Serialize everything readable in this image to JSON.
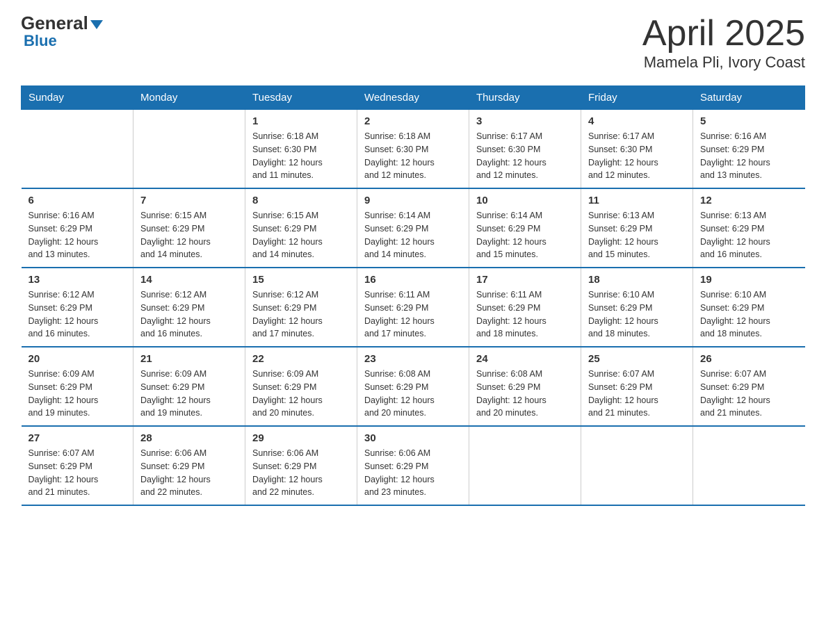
{
  "logo": {
    "general": "General",
    "blue": "Blue",
    "arrow": "▼"
  },
  "title": "April 2025",
  "subtitle": "Mamela Pli, Ivory Coast",
  "header_days": [
    "Sunday",
    "Monday",
    "Tuesday",
    "Wednesday",
    "Thursday",
    "Friday",
    "Saturday"
  ],
  "weeks": [
    [
      {
        "day": "",
        "info": ""
      },
      {
        "day": "",
        "info": ""
      },
      {
        "day": "1",
        "info": "Sunrise: 6:18 AM\nSunset: 6:30 PM\nDaylight: 12 hours\nand 11 minutes."
      },
      {
        "day": "2",
        "info": "Sunrise: 6:18 AM\nSunset: 6:30 PM\nDaylight: 12 hours\nand 12 minutes."
      },
      {
        "day": "3",
        "info": "Sunrise: 6:17 AM\nSunset: 6:30 PM\nDaylight: 12 hours\nand 12 minutes."
      },
      {
        "day": "4",
        "info": "Sunrise: 6:17 AM\nSunset: 6:30 PM\nDaylight: 12 hours\nand 12 minutes."
      },
      {
        "day": "5",
        "info": "Sunrise: 6:16 AM\nSunset: 6:29 PM\nDaylight: 12 hours\nand 13 minutes."
      }
    ],
    [
      {
        "day": "6",
        "info": "Sunrise: 6:16 AM\nSunset: 6:29 PM\nDaylight: 12 hours\nand 13 minutes."
      },
      {
        "day": "7",
        "info": "Sunrise: 6:15 AM\nSunset: 6:29 PM\nDaylight: 12 hours\nand 14 minutes."
      },
      {
        "day": "8",
        "info": "Sunrise: 6:15 AM\nSunset: 6:29 PM\nDaylight: 12 hours\nand 14 minutes."
      },
      {
        "day": "9",
        "info": "Sunrise: 6:14 AM\nSunset: 6:29 PM\nDaylight: 12 hours\nand 14 minutes."
      },
      {
        "day": "10",
        "info": "Sunrise: 6:14 AM\nSunset: 6:29 PM\nDaylight: 12 hours\nand 15 minutes."
      },
      {
        "day": "11",
        "info": "Sunrise: 6:13 AM\nSunset: 6:29 PM\nDaylight: 12 hours\nand 15 minutes."
      },
      {
        "day": "12",
        "info": "Sunrise: 6:13 AM\nSunset: 6:29 PM\nDaylight: 12 hours\nand 16 minutes."
      }
    ],
    [
      {
        "day": "13",
        "info": "Sunrise: 6:12 AM\nSunset: 6:29 PM\nDaylight: 12 hours\nand 16 minutes."
      },
      {
        "day": "14",
        "info": "Sunrise: 6:12 AM\nSunset: 6:29 PM\nDaylight: 12 hours\nand 16 minutes."
      },
      {
        "day": "15",
        "info": "Sunrise: 6:12 AM\nSunset: 6:29 PM\nDaylight: 12 hours\nand 17 minutes."
      },
      {
        "day": "16",
        "info": "Sunrise: 6:11 AM\nSunset: 6:29 PM\nDaylight: 12 hours\nand 17 minutes."
      },
      {
        "day": "17",
        "info": "Sunrise: 6:11 AM\nSunset: 6:29 PM\nDaylight: 12 hours\nand 18 minutes."
      },
      {
        "day": "18",
        "info": "Sunrise: 6:10 AM\nSunset: 6:29 PM\nDaylight: 12 hours\nand 18 minutes."
      },
      {
        "day": "19",
        "info": "Sunrise: 6:10 AM\nSunset: 6:29 PM\nDaylight: 12 hours\nand 18 minutes."
      }
    ],
    [
      {
        "day": "20",
        "info": "Sunrise: 6:09 AM\nSunset: 6:29 PM\nDaylight: 12 hours\nand 19 minutes."
      },
      {
        "day": "21",
        "info": "Sunrise: 6:09 AM\nSunset: 6:29 PM\nDaylight: 12 hours\nand 19 minutes."
      },
      {
        "day": "22",
        "info": "Sunrise: 6:09 AM\nSunset: 6:29 PM\nDaylight: 12 hours\nand 20 minutes."
      },
      {
        "day": "23",
        "info": "Sunrise: 6:08 AM\nSunset: 6:29 PM\nDaylight: 12 hours\nand 20 minutes."
      },
      {
        "day": "24",
        "info": "Sunrise: 6:08 AM\nSunset: 6:29 PM\nDaylight: 12 hours\nand 20 minutes."
      },
      {
        "day": "25",
        "info": "Sunrise: 6:07 AM\nSunset: 6:29 PM\nDaylight: 12 hours\nand 21 minutes."
      },
      {
        "day": "26",
        "info": "Sunrise: 6:07 AM\nSunset: 6:29 PM\nDaylight: 12 hours\nand 21 minutes."
      }
    ],
    [
      {
        "day": "27",
        "info": "Sunrise: 6:07 AM\nSunset: 6:29 PM\nDaylight: 12 hours\nand 21 minutes."
      },
      {
        "day": "28",
        "info": "Sunrise: 6:06 AM\nSunset: 6:29 PM\nDaylight: 12 hours\nand 22 minutes."
      },
      {
        "day": "29",
        "info": "Sunrise: 6:06 AM\nSunset: 6:29 PM\nDaylight: 12 hours\nand 22 minutes."
      },
      {
        "day": "30",
        "info": "Sunrise: 6:06 AM\nSunset: 6:29 PM\nDaylight: 12 hours\nand 23 minutes."
      },
      {
        "day": "",
        "info": ""
      },
      {
        "day": "",
        "info": ""
      },
      {
        "day": "",
        "info": ""
      }
    ]
  ]
}
